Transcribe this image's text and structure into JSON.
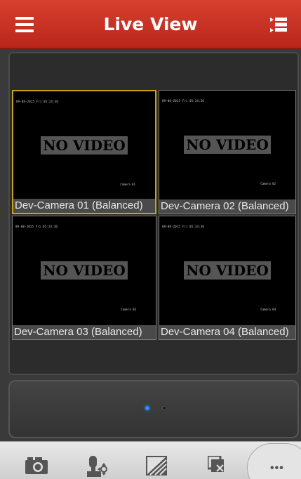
{
  "header": {
    "title": "Live View",
    "menu_icon": "hamburger-menu-icon",
    "list_icon": "device-list-icon"
  },
  "colors": {
    "header": "#c8311f",
    "selected_border": "#c8a316",
    "active_dot": "#2a8cff"
  },
  "cameras": [
    {
      "label": "Dev-Camera 01 (Balanced)",
      "no_video": "NO VIDEO",
      "osd_time": "09-08-2015 Fri 05:24:30",
      "osd_name": "Camera 01",
      "selected": true
    },
    {
      "label": "Dev-Camera 02 (Balanced)",
      "no_video": "NO VIDEO",
      "osd_time": "09-08-2015 Fri 05:24:30",
      "osd_name": "Camera 02",
      "selected": false
    },
    {
      "label": "Dev-Camera 03 (Balanced)",
      "no_video": "NO VIDEO",
      "osd_time": "09-08-2015 Fri 05:24:30",
      "osd_name": "Camera 03",
      "selected": false
    },
    {
      "label": "Dev-Camera 04 (Balanced)",
      "no_video": "NO VIDEO",
      "osd_time": "09-08-2015 Fri 05:24:30",
      "osd_name": "Camera 04",
      "selected": false
    }
  ],
  "pager": {
    "current": 1,
    "total": 2
  },
  "toolbar": {
    "items": [
      "camera-snapshot-icon",
      "ptz-control-icon",
      "image-quality-icon",
      "close-window-icon"
    ],
    "more_label": "•••"
  }
}
